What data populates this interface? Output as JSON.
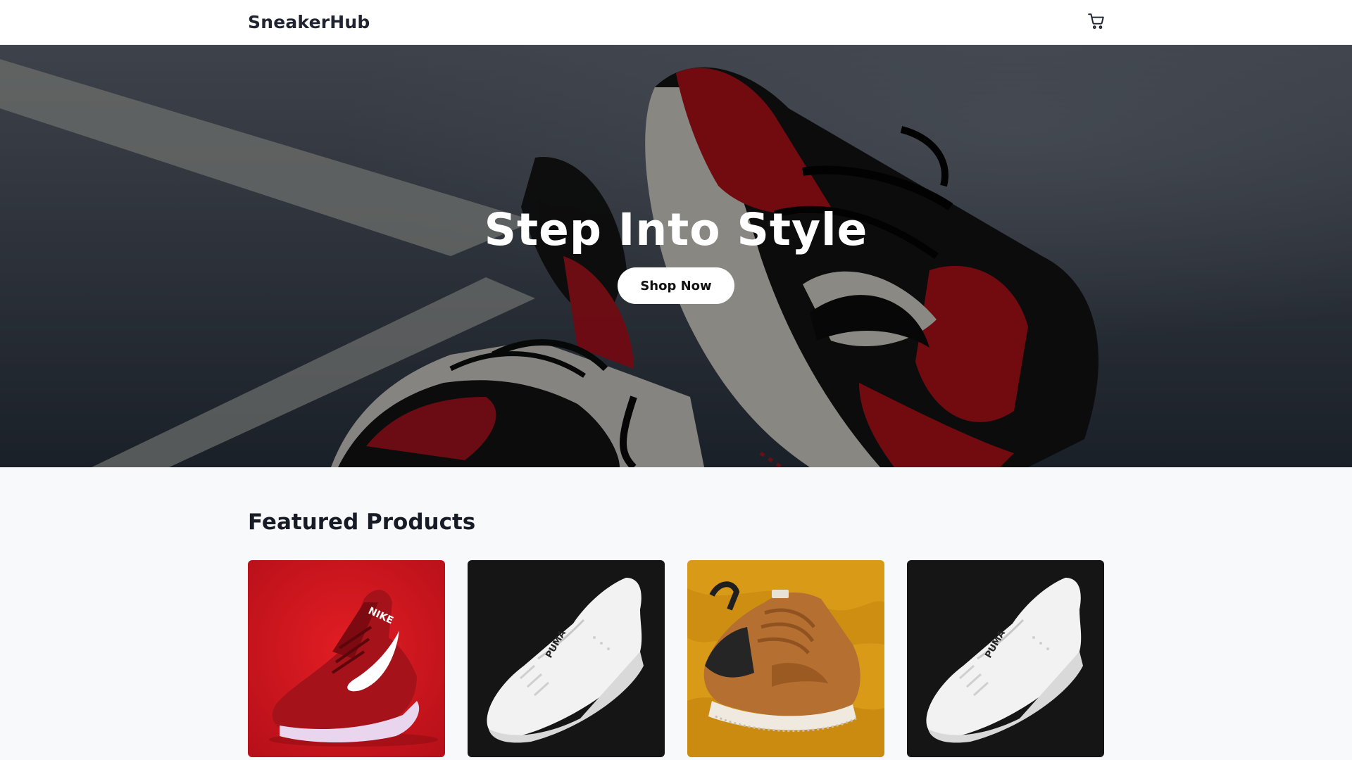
{
  "header": {
    "brand": "SneakerHub",
    "cart_icon": "shopping-cart-icon"
  },
  "hero": {
    "title": "Step Into Style",
    "cta_label": "Shop Now",
    "image": "sneaker-photo"
  },
  "featured": {
    "title": "Featured Products",
    "products": [
      {
        "image": "red-knit-running-shoe-photo",
        "background": "#d81a1f"
      },
      {
        "image": "white-leather-sneaker-photo",
        "background": "#151515"
      },
      {
        "image": "brown-canvas-sneaker-photo",
        "background": "#d99a17"
      },
      {
        "image": "white-leather-sneaker-photo",
        "background": "#151515"
      }
    ]
  },
  "colors": {
    "header_bg": "#ffffff",
    "page_bg": "#f8f9fb",
    "text": "#1a1f2b",
    "cta_bg": "#ffffff"
  }
}
